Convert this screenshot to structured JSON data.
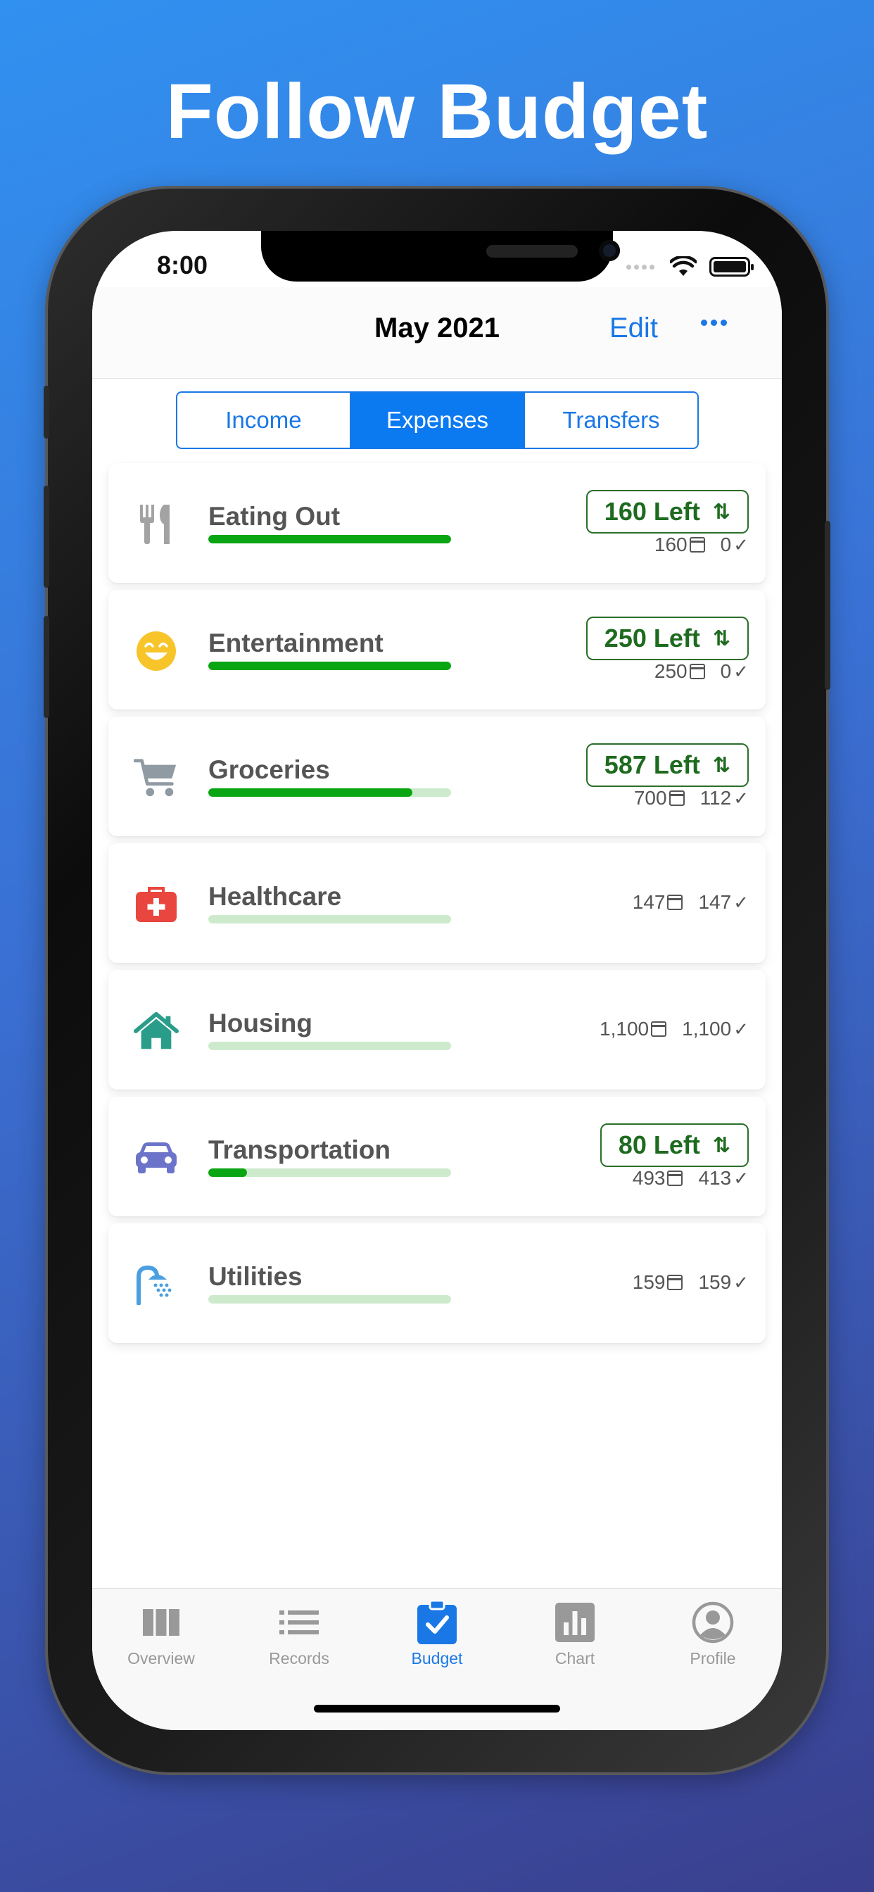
{
  "headline": "Follow Budget",
  "status_bar": {
    "time": "8:00"
  },
  "nav": {
    "title": "May 2021",
    "edit_label": "Edit"
  },
  "segments": [
    {
      "label": "Income",
      "active": false
    },
    {
      "label": "Expenses",
      "active": true
    },
    {
      "label": "Transfers",
      "active": false
    }
  ],
  "categories": [
    {
      "name": "Eating Out",
      "icon": "utensils-icon",
      "progress": 1.0,
      "left": "160 Left",
      "budget": "160",
      "spent": "0"
    },
    {
      "name": "Entertainment",
      "icon": "smiley-icon",
      "progress": 1.0,
      "left": "250 Left",
      "budget": "250",
      "spent": "0"
    },
    {
      "name": "Groceries",
      "icon": "cart-icon",
      "progress": 0.84,
      "left": "587 Left",
      "budget": "700",
      "spent": "112"
    },
    {
      "name": "Healthcare",
      "icon": "first-aid-icon",
      "progress": 0.0,
      "left": null,
      "budget": "147",
      "spent": "147"
    },
    {
      "name": "Housing",
      "icon": "house-icon",
      "progress": 0.0,
      "left": null,
      "budget": "1,100",
      "spent": "1,100"
    },
    {
      "name": "Transportation",
      "icon": "car-icon",
      "progress": 0.16,
      "left": "80 Left",
      "budget": "493",
      "spent": "413"
    },
    {
      "name": "Utilities",
      "icon": "shower-icon",
      "progress": 0.0,
      "left": null,
      "budget": "159",
      "spent": "159"
    }
  ],
  "tabs": [
    {
      "label": "Overview",
      "icon": "columns-icon",
      "active": false
    },
    {
      "label": "Records",
      "icon": "list-icon",
      "active": false
    },
    {
      "label": "Budget",
      "icon": "clipboard-check-icon",
      "active": true
    },
    {
      "label": "Chart",
      "icon": "bar-chart-icon",
      "active": false
    },
    {
      "label": "Profile",
      "icon": "user-circle-icon",
      "active": false
    }
  ],
  "colors": {
    "accent": "#1a78e6",
    "progress_fill": "#09a512",
    "progress_track": "#cdebcc",
    "left_badge": "#1e6b1f"
  }
}
